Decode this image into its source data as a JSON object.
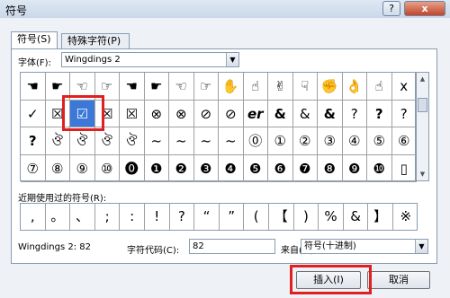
{
  "title": "符号",
  "title_buttons": {
    "help": "?",
    "close": "x"
  },
  "tabs": [
    "符号(S)",
    "特殊字符(P)"
  ],
  "font": {
    "label": "字体(F):",
    "value": "Wingdings 2"
  },
  "symbols": [
    [
      "☚",
      "☛",
      "☜",
      "☞",
      "☚",
      "☛",
      "☜",
      "☞",
      "✋",
      "☝",
      "✌",
      "☟",
      "✊",
      "👌",
      "☝",
      "✋",
      "x"
    ],
    [
      "✓",
      "☒",
      "☑",
      "☒",
      "☒",
      "⊗",
      "⊗",
      "⊘",
      "⊘",
      "er",
      "&",
      "&",
      "&",
      "?",
      "?",
      "?"
    ],
    [
      "?",
      "ঔ",
      "ঔ",
      "ঔ",
      "ঔ",
      "~",
      "~",
      "~",
      "~",
      "⓪",
      "①",
      "②",
      "③",
      "④",
      "⑤",
      "⑥"
    ],
    [
      "⑦",
      "⑧",
      "⑨",
      "⑩",
      "⓿",
      "❶",
      "❷",
      "❸",
      "❹",
      "❺",
      "❻",
      "❼",
      "❽",
      "❾",
      "❿",
      "▯"
    ]
  ],
  "selected_symbol": "☑",
  "recent": {
    "label": "近期使用过的符号(R):",
    "symbols": [
      ",",
      "。",
      "、",
      ";",
      ":",
      "!",
      "?",
      "“",
      "”",
      "(",
      "【",
      ")",
      "%",
      "&",
      "】",
      "※"
    ]
  },
  "status": {
    "name": "Wingdings 2: 82",
    "code_label": "字符代码(C):",
    "code_value": "82",
    "from_label": "来自(M):",
    "from_value": "符号(十进制)"
  },
  "buttons": {
    "insert": "插入(I)",
    "cancel": "取消"
  }
}
